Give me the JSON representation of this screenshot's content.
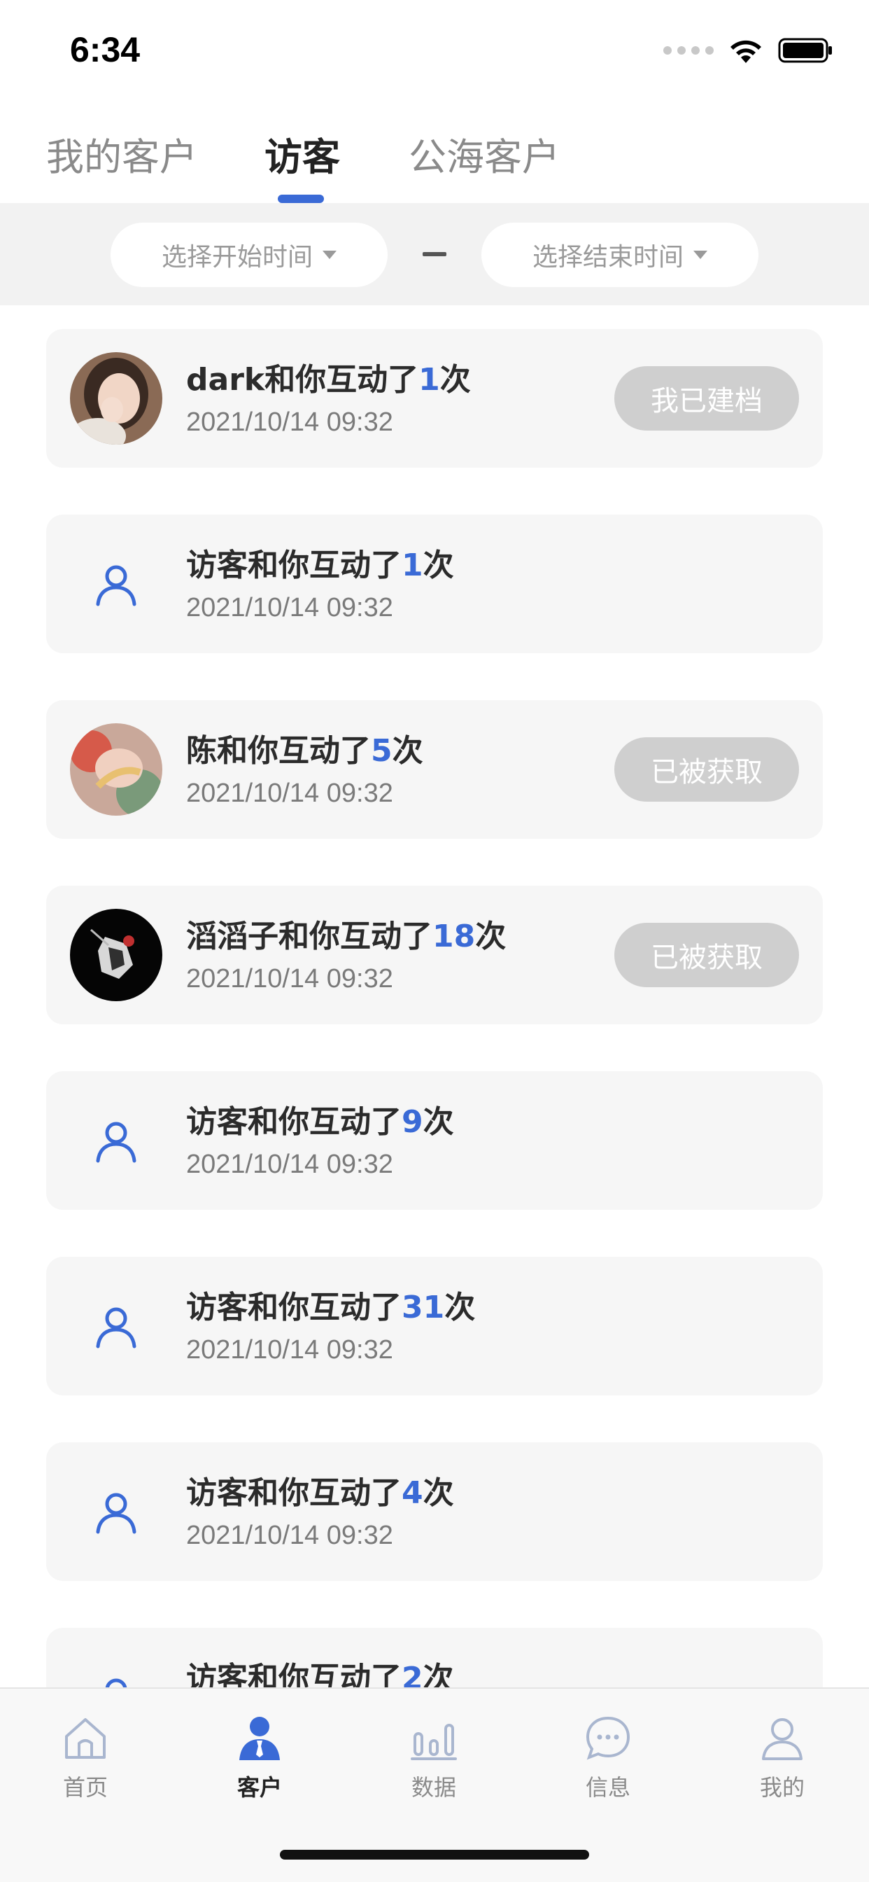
{
  "status_bar": {
    "time": "6:34"
  },
  "top_tabs": [
    {
      "label": "我的客户",
      "active": false
    },
    {
      "label": "访客",
      "active": true
    },
    {
      "label": "公海客户",
      "active": false
    }
  ],
  "filter": {
    "start_placeholder": "选择开始时间",
    "end_placeholder": "选择结束时间",
    "separator": "—"
  },
  "visitors": [
    {
      "name": "dark",
      "text_mid": "和你互动了",
      "count": "1",
      "unit": "次",
      "time": "2021/10/14   09:32",
      "avatar": "photo-girl",
      "status": "我已建档"
    },
    {
      "name": "访客",
      "text_mid": "和你互动了",
      "count": "1",
      "unit": "次",
      "time": "2021/10/14   09:32",
      "avatar": "person-icon",
      "status": ""
    },
    {
      "name": "陈",
      "text_mid": "和你互动了",
      "count": "5",
      "unit": "次",
      "time": "2021/10/14   09:32",
      "avatar": "photo-baby",
      "status": "已被获取"
    },
    {
      "name": "滔滔子",
      "text_mid": "和你互动了",
      "count": "18",
      "unit": "次",
      "time": "2021/10/14   09:32",
      "avatar": "photo-dark",
      "status": "已被获取"
    },
    {
      "name": "访客",
      "text_mid": "和你互动了",
      "count": "9",
      "unit": "次",
      "time": "2021/10/14   09:32",
      "avatar": "person-icon",
      "status": ""
    },
    {
      "name": "访客",
      "text_mid": "和你互动了",
      "count": "31",
      "unit": "次",
      "time": "2021/10/14   09:32",
      "avatar": "person-icon",
      "status": ""
    },
    {
      "name": "访客",
      "text_mid": "和你互动了",
      "count": "4",
      "unit": "次",
      "time": "2021/10/14   09:32",
      "avatar": "person-icon",
      "status": ""
    },
    {
      "name": "访客",
      "text_mid": "和你互动了",
      "count": "2",
      "unit": "次",
      "time": "",
      "avatar": "person-icon",
      "status": ""
    }
  ],
  "bottom_nav": [
    {
      "label": "首页",
      "icon": "home-icon",
      "active": false
    },
    {
      "label": "客户",
      "icon": "customer-icon",
      "active": true
    },
    {
      "label": "数据",
      "icon": "data-icon",
      "active": false
    },
    {
      "label": "信息",
      "icon": "message-icon",
      "active": false
    },
    {
      "label": "我的",
      "icon": "profile-icon",
      "active": false
    }
  ],
  "colors": {
    "accent": "#3a6ad6",
    "card_bg": "#f6f6f6",
    "button_disabled": "#cfcfcf"
  }
}
